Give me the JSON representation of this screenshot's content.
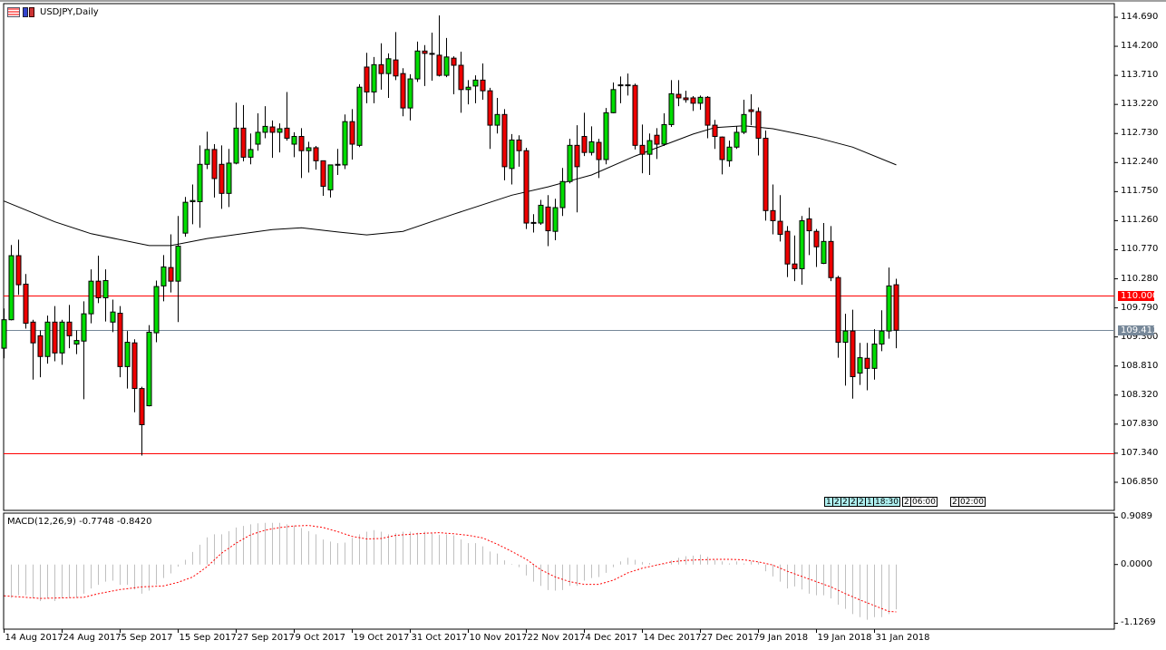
{
  "header": {
    "title": "USDJPY,Daily"
  },
  "colors": {
    "bull": "#00dd00",
    "bear": "#ee0000",
    "level": "#ff0000",
    "bid": "#778899",
    "ma": "#000000",
    "hist": "#c0c0c0",
    "signal": "#ff0000"
  },
  "price_axis": {
    "ticks": [
      "114.690",
      "114.200",
      "113.710",
      "113.220",
      "112.730",
      "112.240",
      "111.750",
      "111.260",
      "110.770",
      "110.280",
      "109.790",
      "109.300",
      "108.810",
      "108.320",
      "107.830",
      "107.340",
      "106.850"
    ],
    "level_label": "110.000",
    "bid_label": "109.413"
  },
  "macd_axis": {
    "ticks": [
      "0.9089",
      "0.0000",
      "-1.1269"
    ]
  },
  "macd_label": "MACD(12,26,9) -0.7748 -0.8420",
  "events": [
    {
      "text": "1",
      "kind": "c"
    },
    {
      "text": "2",
      "kind": "c"
    },
    {
      "text": "2",
      "kind": "c"
    },
    {
      "text": "2",
      "kind": "c"
    },
    {
      "text": "2",
      "kind": "c"
    },
    {
      "text": "1",
      "kind": "c"
    },
    {
      "text": "18:30",
      "kind": "c"
    },
    {
      "text": "2",
      "kind": "w"
    },
    {
      "text": "06:00",
      "kind": "w"
    },
    {
      "text": "2",
      "kind": "w"
    },
    {
      "text": "02:00",
      "kind": "w"
    }
  ],
  "chart_data": {
    "type": "candlestick",
    "title": "USDJPY,Daily",
    "ylim": [
      106.85,
      114.69
    ],
    "x_tick_labels": [
      "14 Aug 2017",
      "24 Aug 2017",
      "5 Sep 2017",
      "15 Sep 2017",
      "27 Sep 2017",
      "9 Oct 2017",
      "19 Oct 2017",
      "31 Oct 2017",
      "10 Nov 2017",
      "22 Nov 2017",
      "4 Dec 2017",
      "14 Dec 2017",
      "27 Dec 2017",
      "9 Jan 2018",
      "19 Jan 2018",
      "31 Jan 2018"
    ],
    "x_tick_every_bars": 8,
    "horizontal_levels": [
      110.0,
      107.34
    ],
    "bid": 109.413,
    "candles_ohlc": [
      [
        109.11,
        109.78,
        108.94,
        109.59
      ],
      [
        109.59,
        110.85,
        109.58,
        110.67
      ],
      [
        110.67,
        110.94,
        110.01,
        110.18
      ],
      [
        110.19,
        110.36,
        109.44,
        109.53
      ],
      [
        109.55,
        109.59,
        108.58,
        109.2
      ],
      [
        109.32,
        109.41,
        108.62,
        108.97
      ],
      [
        108.97,
        109.66,
        108.85,
        109.55
      ],
      [
        109.55,
        109.82,
        108.89,
        109.03
      ],
      [
        109.03,
        109.59,
        108.83,
        109.55
      ],
      [
        109.55,
        109.84,
        109.11,
        109.32
      ],
      [
        109.18,
        109.41,
        109.01,
        109.24
      ],
      [
        109.23,
        109.9,
        108.25,
        109.69
      ],
      [
        109.69,
        110.44,
        109.53,
        110.24
      ],
      [
        110.24,
        110.67,
        109.87,
        109.96
      ],
      [
        109.96,
        110.44,
        109.56,
        110.25
      ],
      [
        109.55,
        109.93,
        109.38,
        109.72
      ],
      [
        109.7,
        109.82,
        108.62,
        108.8
      ],
      [
        108.8,
        109.4,
        108.43,
        109.21
      ],
      [
        109.2,
        109.26,
        108.03,
        108.43
      ],
      [
        108.43,
        108.46,
        107.3,
        107.82
      ],
      [
        108.14,
        109.5,
        108.13,
        109.38
      ],
      [
        109.37,
        110.25,
        109.21,
        110.15
      ],
      [
        110.16,
        110.68,
        109.9,
        110.48
      ],
      [
        110.47,
        111.03,
        110.05,
        110.24
      ],
      [
        110.24,
        111.34,
        109.55,
        110.83
      ],
      [
        111.05,
        111.66,
        110.99,
        111.57
      ],
      [
        111.58,
        111.87,
        111.2,
        111.6
      ],
      [
        111.58,
        112.53,
        111.14,
        112.21
      ],
      [
        112.21,
        112.76,
        112.13,
        112.46
      ],
      [
        112.46,
        112.55,
        111.65,
        111.97
      ],
      [
        112.21,
        112.53,
        111.46,
        111.72
      ],
      [
        111.72,
        112.47,
        111.49,
        112.23
      ],
      [
        112.23,
        113.25,
        112.21,
        112.82
      ],
      [
        112.82,
        113.21,
        112.26,
        112.33
      ],
      [
        112.33,
        112.73,
        112.21,
        112.46
      ],
      [
        112.55,
        113.07,
        112.44,
        112.75
      ],
      [
        112.75,
        113.19,
        112.65,
        112.85
      ],
      [
        112.84,
        112.95,
        112.32,
        112.75
      ],
      [
        112.75,
        112.9,
        112.41,
        112.81
      ],
      [
        112.82,
        113.43,
        112.61,
        112.65
      ],
      [
        112.55,
        112.75,
        112.33,
        112.68
      ],
      [
        112.68,
        112.82,
        111.98,
        112.44
      ],
      [
        112.44,
        112.59,
        112.07,
        112.49
      ],
      [
        112.49,
        112.52,
        112.12,
        112.27
      ],
      [
        112.27,
        112.27,
        111.68,
        111.84
      ],
      [
        111.78,
        112.2,
        111.65,
        112.2
      ],
      [
        112.2,
        112.47,
        112.03,
        112.21
      ],
      [
        112.2,
        113.05,
        112.13,
        112.93
      ],
      [
        112.93,
        113.14,
        112.29,
        112.55
      ],
      [
        112.53,
        113.56,
        112.5,
        113.51
      ],
      [
        113.85,
        114.09,
        113.24,
        113.43
      ],
      [
        113.43,
        114.02,
        113.24,
        113.89
      ],
      [
        113.89,
        114.25,
        113.47,
        113.74
      ],
      [
        113.74,
        114.08,
        113.33,
        113.99
      ],
      [
        113.97,
        114.44,
        113.63,
        113.7
      ],
      [
        113.74,
        113.83,
        113.02,
        113.16
      ],
      [
        113.16,
        113.73,
        112.95,
        113.65
      ],
      [
        113.65,
        114.28,
        113.6,
        114.12
      ],
      [
        114.12,
        114.22,
        113.53,
        114.08
      ],
      [
        114.08,
        114.43,
        113.62,
        114.07
      ],
      [
        114.05,
        114.72,
        113.69,
        113.71
      ],
      [
        113.71,
        114.34,
        113.68,
        114.02
      ],
      [
        114.0,
        114.03,
        113.39,
        113.88
      ],
      [
        113.88,
        114.11,
        113.08,
        113.47
      ],
      [
        113.47,
        113.63,
        113.22,
        113.51
      ],
      [
        113.53,
        113.71,
        113.24,
        113.63
      ],
      [
        113.63,
        113.91,
        113.3,
        113.45
      ],
      [
        113.45,
        113.5,
        112.47,
        112.87
      ],
      [
        112.87,
        113.33,
        112.73,
        113.05
      ],
      [
        113.05,
        113.14,
        111.94,
        112.17
      ],
      [
        112.14,
        112.72,
        111.87,
        112.62
      ],
      [
        112.62,
        112.7,
        112.17,
        112.44
      ],
      [
        112.44,
        112.49,
        111.12,
        111.22
      ],
      [
        111.22,
        111.37,
        111.06,
        111.23
      ],
      [
        111.22,
        111.61,
        111.19,
        111.52
      ],
      [
        111.49,
        111.69,
        110.83,
        111.09
      ],
      [
        111.08,
        111.63,
        110.93,
        111.48
      ],
      [
        111.48,
        112.15,
        111.34,
        111.92
      ],
      [
        111.92,
        112.64,
        111.89,
        112.53
      ],
      [
        112.53,
        112.87,
        111.4,
        112.17
      ],
      [
        112.68,
        113.08,
        112.35,
        112.41
      ],
      [
        112.41,
        112.85,
        112.36,
        112.59
      ],
      [
        112.58,
        112.64,
        111.98,
        112.29
      ],
      [
        112.29,
        113.16,
        112.21,
        113.08
      ],
      [
        113.08,
        113.59,
        113.07,
        113.47
      ],
      [
        113.54,
        113.69,
        113.24,
        113.55
      ],
      [
        113.54,
        113.74,
        113.37,
        113.55
      ],
      [
        113.54,
        113.57,
        112.46,
        112.53
      ],
      [
        112.53,
        112.88,
        112.06,
        112.38
      ],
      [
        112.38,
        112.73,
        112.03,
        112.61
      ],
      [
        112.7,
        112.82,
        112.3,
        112.55
      ],
      [
        112.55,
        113.07,
        112.52,
        112.88
      ],
      [
        112.88,
        113.63,
        112.84,
        113.4
      ],
      [
        113.39,
        113.63,
        113.19,
        113.33
      ],
      [
        113.33,
        113.45,
        113.25,
        113.3
      ],
      [
        113.33,
        113.36,
        113.11,
        113.24
      ],
      [
        113.24,
        113.37,
        113.13,
        113.34
      ],
      [
        113.34,
        113.36,
        112.65,
        112.87
      ],
      [
        112.87,
        112.96,
        112.47,
        112.68
      ],
      [
        112.67,
        112.68,
        112.04,
        112.29
      ],
      [
        112.27,
        112.61,
        112.17,
        112.5
      ],
      [
        112.5,
        112.85,
        112.47,
        112.75
      ],
      [
        112.75,
        113.3,
        112.72,
        113.05
      ],
      [
        113.13,
        113.39,
        112.87,
        113.1
      ],
      [
        113.1,
        113.17,
        112.36,
        112.65
      ],
      [
        112.65,
        112.78,
        111.26,
        111.43
      ],
      [
        111.43,
        111.87,
        111.03,
        111.26
      ],
      [
        111.25,
        111.69,
        110.91,
        111.03
      ],
      [
        111.08,
        111.17,
        110.31,
        110.53
      ],
      [
        110.53,
        111.01,
        110.24,
        110.45
      ],
      [
        110.45,
        111.34,
        110.18,
        111.26
      ],
      [
        111.29,
        111.48,
        110.68,
        111.09
      ],
      [
        111.08,
        111.12,
        110.48,
        110.82
      ],
      [
        110.54,
        111.22,
        110.53,
        110.91
      ],
      [
        110.91,
        111.17,
        110.24,
        110.3
      ],
      [
        110.3,
        110.33,
        108.95,
        109.21
      ],
      [
        109.21,
        109.69,
        108.48,
        109.4
      ],
      [
        109.4,
        109.76,
        108.26,
        108.63
      ],
      [
        108.69,
        109.2,
        108.49,
        108.95
      ],
      [
        108.94,
        109.2,
        108.4,
        108.77
      ],
      [
        108.77,
        109.43,
        108.58,
        109.18
      ],
      [
        109.18,
        109.75,
        109.06,
        109.4
      ],
      [
        109.4,
        110.47,
        109.27,
        110.16
      ],
      [
        110.18,
        110.28,
        109.11,
        109.413
      ]
    ],
    "moving_average": [
      [
        0,
        111.59
      ],
      [
        7,
        111.24
      ],
      [
        12,
        111.04
      ],
      [
        20,
        110.84
      ],
      [
        23,
        110.84
      ],
      [
        28,
        110.96
      ],
      [
        37,
        111.11
      ],
      [
        41,
        111.14
      ],
      [
        46,
        111.07
      ],
      [
        50,
        111.02
      ],
      [
        55,
        111.08
      ],
      [
        62,
        111.37
      ],
      [
        70,
        111.69
      ],
      [
        75,
        111.83
      ],
      [
        81,
        112.03
      ],
      [
        87,
        112.35
      ],
      [
        95,
        112.72
      ],
      [
        98,
        112.83
      ],
      [
        102,
        112.86
      ],
      [
        106,
        112.81
      ],
      [
        112,
        112.66
      ],
      [
        117,
        112.5
      ],
      [
        123,
        112.2
      ]
    ],
    "macd": {
      "ylim": [
        -1.1269,
        0.9089
      ],
      "histogram": [
        -0.62,
        -0.64,
        -0.59,
        -0.59,
        -0.64,
        -0.7,
        -0.65,
        -0.7,
        -0.64,
        -0.64,
        -0.63,
        -0.56,
        -0.46,
        -0.39,
        -0.33,
        -0.31,
        -0.39,
        -0.39,
        -0.48,
        -0.56,
        -0.5,
        -0.39,
        -0.26,
        -0.17,
        -0.04,
        0.09,
        0.24,
        0.38,
        0.52,
        0.58,
        0.58,
        0.64,
        0.71,
        0.74,
        0.77,
        0.79,
        0.8,
        0.8,
        0.8,
        0.77,
        0.75,
        0.7,
        0.64,
        0.58,
        0.48,
        0.44,
        0.41,
        0.42,
        0.51,
        0.58,
        0.63,
        0.66,
        0.63,
        0.58,
        0.6,
        0.63,
        0.63,
        0.61,
        0.63,
        0.6,
        0.57,
        0.58,
        0.56,
        0.48,
        0.41,
        0.41,
        0.35,
        0.25,
        0.21,
        0.08,
        0.01,
        -0.05,
        -0.21,
        -0.33,
        -0.41,
        -0.49,
        -0.5,
        -0.49,
        -0.41,
        -0.41,
        -0.31,
        -0.26,
        -0.24,
        -0.16,
        -0.05,
        0.06,
        0.13,
        0.09,
        0.05,
        0.03,
        0.01,
        0.01,
        0.08,
        0.13,
        0.16,
        0.17,
        0.19,
        0.15,
        0.09,
        0.06,
        0.02,
        0.06,
        0.02,
        0.06,
        0.05,
        -0.13,
        -0.23,
        -0.33,
        -0.46,
        -0.42,
        -0.48,
        -0.56,
        -0.59,
        -0.59,
        -0.65,
        -0.77,
        -0.85,
        -0.95,
        -1.01,
        -1.06,
        -1.01,
        -1.01,
        -0.95,
        -0.86
      ],
      "signal": [
        [
          0,
          -0.6
        ],
        [
          5,
          -0.65
        ],
        [
          8,
          -0.64
        ],
        [
          11,
          -0.63
        ],
        [
          13,
          -0.56
        ],
        [
          16,
          -0.48
        ],
        [
          19,
          -0.43
        ],
        [
          22,
          -0.41
        ],
        [
          24,
          -0.34
        ],
        [
          26,
          -0.24
        ],
        [
          28,
          -0.04
        ],
        [
          30,
          0.22
        ],
        [
          32,
          0.41
        ],
        [
          34,
          0.57
        ],
        [
          36,
          0.66
        ],
        [
          38,
          0.71
        ],
        [
          40,
          0.74
        ],
        [
          42,
          0.75
        ],
        [
          44,
          0.71
        ],
        [
          46,
          0.63
        ],
        [
          48,
          0.54
        ],
        [
          50,
          0.49
        ],
        [
          52,
          0.5
        ],
        [
          54,
          0.56
        ],
        [
          56,
          0.58
        ],
        [
          58,
          0.6
        ],
        [
          60,
          0.61
        ],
        [
          62,
          0.59
        ],
        [
          64,
          0.56
        ],
        [
          66,
          0.51
        ],
        [
          68,
          0.39
        ],
        [
          70,
          0.25
        ],
        [
          72,
          0.1
        ],
        [
          74,
          -0.1
        ],
        [
          76,
          -0.24
        ],
        [
          78,
          -0.33
        ],
        [
          80,
          -0.38
        ],
        [
          82,
          -0.38
        ],
        [
          84,
          -0.3
        ],
        [
          86,
          -0.16
        ],
        [
          88,
          -0.07
        ],
        [
          90,
          -0.01
        ],
        [
          92,
          0.05
        ],
        [
          94,
          0.08
        ],
        [
          96,
          0.09
        ],
        [
          98,
          0.1
        ],
        [
          100,
          0.1
        ],
        [
          102,
          0.09
        ],
        [
          104,
          0.05
        ],
        [
          106,
          -0.01
        ],
        [
          108,
          -0.13
        ],
        [
          110,
          -0.23
        ],
        [
          112,
          -0.33
        ],
        [
          114,
          -0.43
        ],
        [
          116,
          -0.56
        ],
        [
          118,
          -0.68
        ],
        [
          120,
          -0.79
        ],
        [
          122,
          -0.9
        ],
        [
          123,
          -0.91
        ]
      ]
    }
  }
}
